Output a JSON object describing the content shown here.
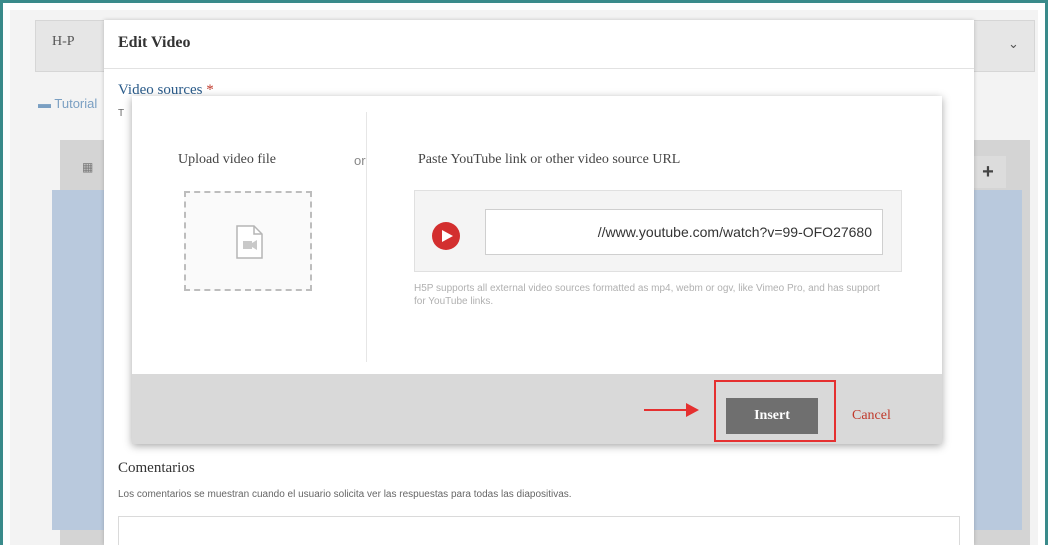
{
  "background": {
    "h5p_label": "H-P",
    "tutorial_label": "Tutorial"
  },
  "edit_video": {
    "title": "Edit Video",
    "video_sources_label": "Video sources",
    "required_mark": "*",
    "video_sources_hint": "T"
  },
  "dialog": {
    "upload_label": "Upload video file",
    "or_label": "or",
    "paste_label": "Paste YouTube link or other video source URL",
    "url_value": "//www.youtube.com/watch?v=99-OFO27680",
    "url_hint": "H5P supports all external video sources formatted as mp4, webm or ogv, like Vimeo Pro, and has support for YouTube links.",
    "insert_label": "Insert",
    "cancel_label": "Cancel"
  },
  "comments": {
    "label": "Comentarios",
    "hint": "Los comentarios se muestran cuando el usuario solicita ver las respuestas para todas las diapositivas."
  },
  "colors": {
    "frame": "#3a8b8b",
    "highlight": "#e53030",
    "youtube_red": "#d32f2f",
    "cancel_red": "#c0392b"
  }
}
